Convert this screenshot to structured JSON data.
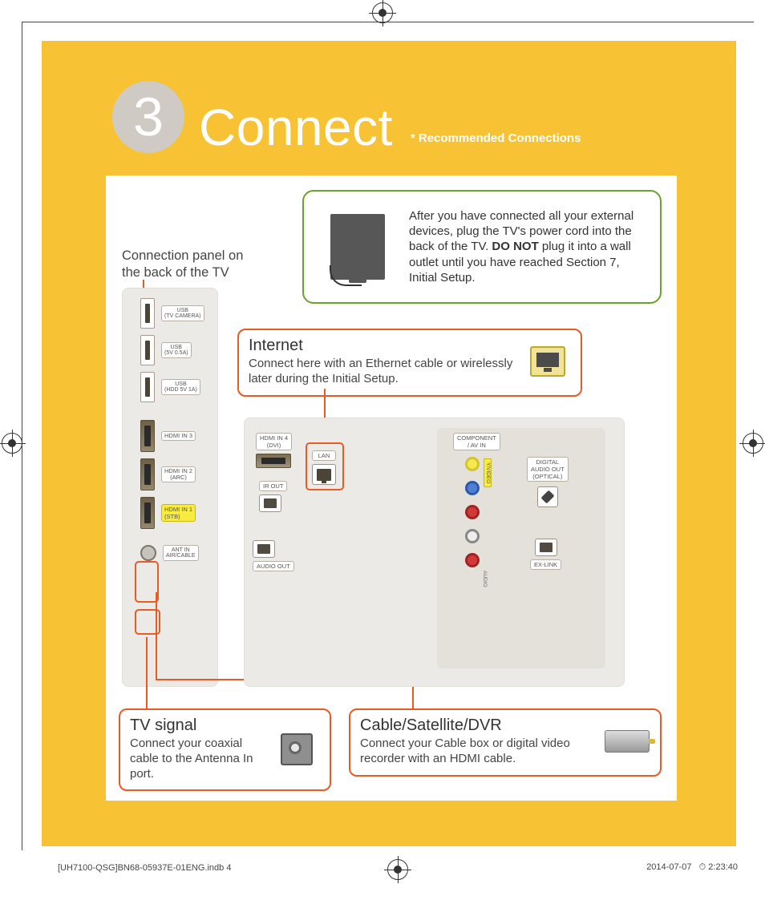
{
  "header": {
    "step_number": "3",
    "title": "Connect",
    "subtitle": "* Recommended Connections"
  },
  "caption_panel": "Connection panel on the back of the TV",
  "green_box": {
    "text_before": "After you have connected all your external devices, plug the TV's power cord into the back of the TV. ",
    "bold": "DO NOT",
    "text_after": " plug it into a wall outlet until you have reached Section 7, Initial Setup."
  },
  "callouts": {
    "internet": {
      "heading": "Internet",
      "body": "Connect here with an Ethernet cable or wirelessly later during the Initial Setup."
    },
    "tv_signal": {
      "heading": "TV signal",
      "body": "Connect your coaxial cable to the Antenna In port."
    },
    "cable": {
      "heading": "Cable/Satellite/DVR",
      "body": "Connect your Cable box or digital video recorder with an HDMI cable."
    }
  },
  "vert_panel": {
    "usb1": "USB\n(TV CAMERA)",
    "usb2": "USB\n(5V 0.5A)",
    "usb3": "USB\n(HDD 5V 1A)",
    "hdmi3": "HDMI IN 3",
    "hdmi2": "HDMI IN 2\n(ARC)",
    "hdmi1": "HDMI IN 1\n(STB)",
    "ant": "ANT IN\nAIR/CABLE"
  },
  "main_panel": {
    "hdmi4": "HDMI IN 4\n(DVI)",
    "irout": "IR OUT",
    "audio_out": "AUDIO OUT",
    "lan": "LAN",
    "component": "COMPONENT\n/ AV IN",
    "digital_audio": "DIGITAL\nAUDIO OUT\n(OPTICAL)",
    "exlink": "EX-LINK",
    "y_video": "Y/VIDEO",
    "audio": "AUDIO"
  },
  "footer": {
    "left": "[UH7100-QSG]BN68-05937E-01ENG.indb   4",
    "date": "2014-07-07",
    "time": "2:23:40"
  }
}
